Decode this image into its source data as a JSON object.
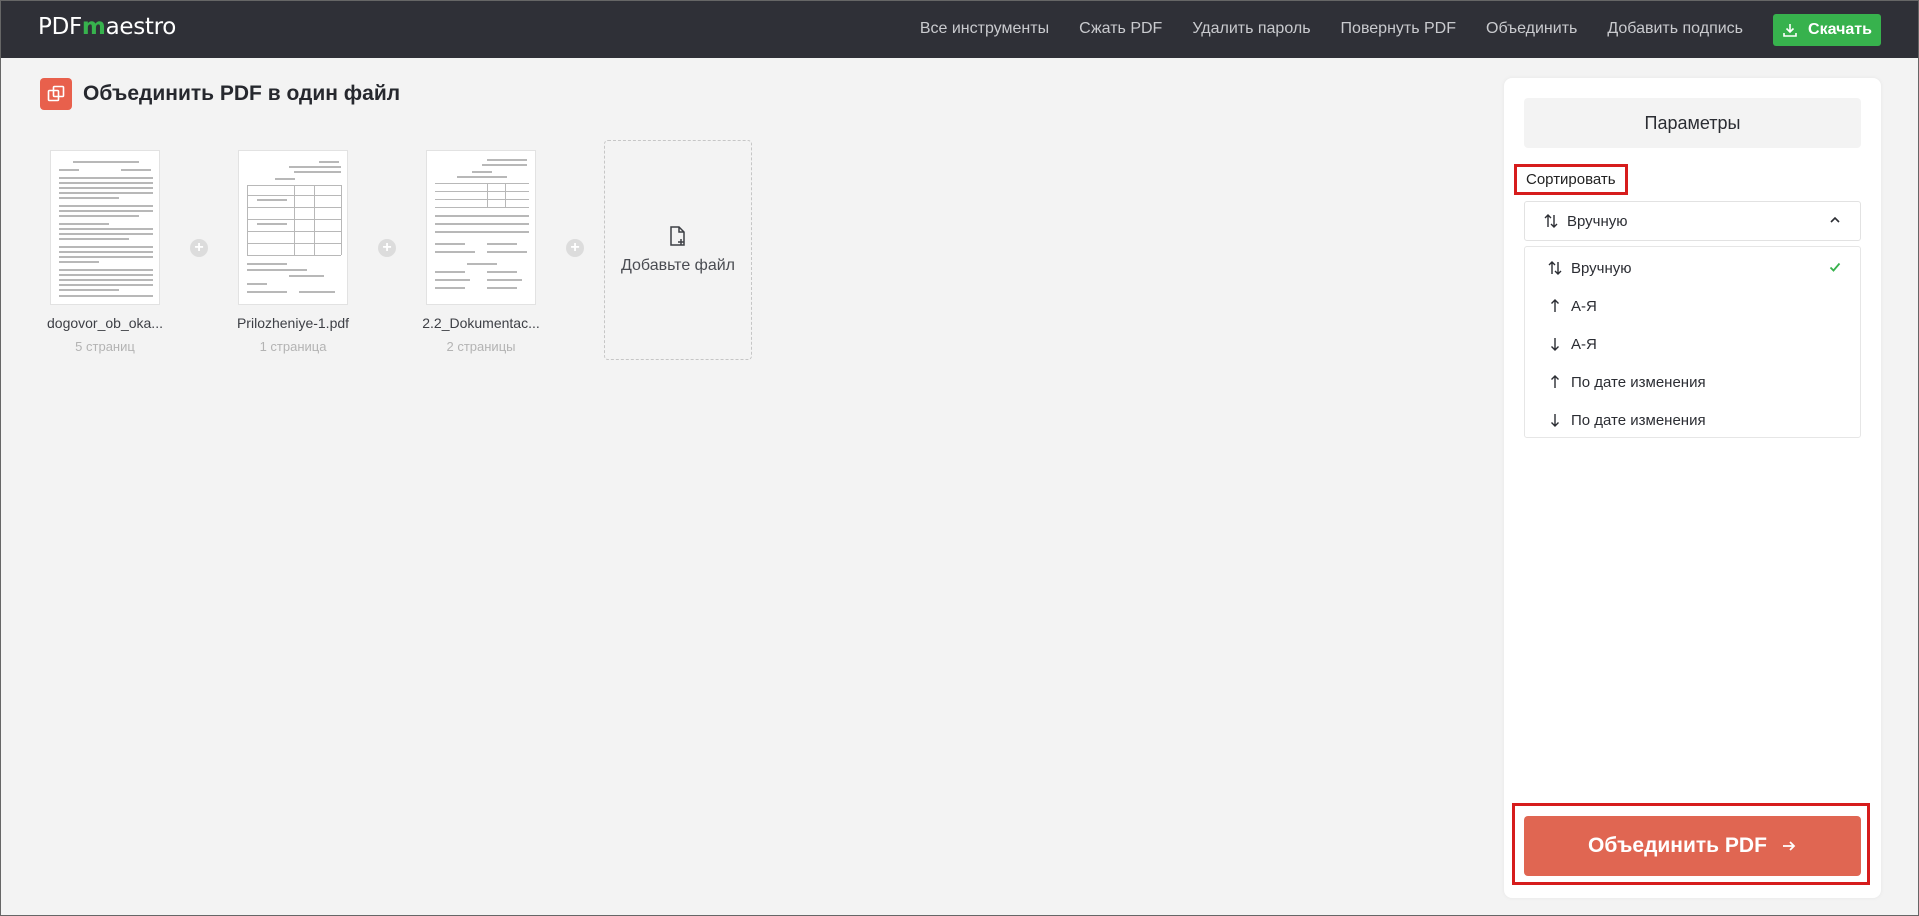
{
  "header": {
    "logo_prefix": "PDF",
    "logo_mark": "m",
    "logo_suffix": "aestro",
    "nav": [
      "Все инструменты",
      "Сжать PDF",
      "Удалить пароль",
      "Повернуть PDF",
      "Объединить",
      "Добавить подпись"
    ],
    "download_label": "Скачать",
    "download_icon": "download-icon",
    "accent": "#37b24d"
  },
  "page": {
    "title": "Объединить PDF в один файл",
    "title_icon": "merge-icon"
  },
  "files": [
    {
      "name": "dogovor_ob_oka...",
      "pages": "5 страниц"
    },
    {
      "name": "Prilozheniye-1.pdf",
      "pages": "1 страница"
    },
    {
      "name": "2.2_Dokumentac...",
      "pages": "2 страницы"
    }
  ],
  "add_file": {
    "label": "Добавьте файл",
    "icon": "add-file-icon"
  },
  "panel": {
    "title": "Параметры",
    "sort_label": "Сортировать",
    "selected": "Вручную",
    "options": [
      {
        "label": "Вручную",
        "icon": "sort-both-icon",
        "selected": true
      },
      {
        "label": "А-Я",
        "icon": "arrow-up-icon",
        "selected": false
      },
      {
        "label": "А-Я",
        "icon": "arrow-down-icon",
        "selected": false
      },
      {
        "label": "По дате изменения",
        "icon": "arrow-up-icon",
        "selected": false
      },
      {
        "label": "По дате изменения",
        "icon": "arrow-down-icon",
        "selected": false
      }
    ],
    "merge_label": "Объединить PDF",
    "merge_color": "#e06652",
    "highlight_color": "#d61c1c"
  }
}
